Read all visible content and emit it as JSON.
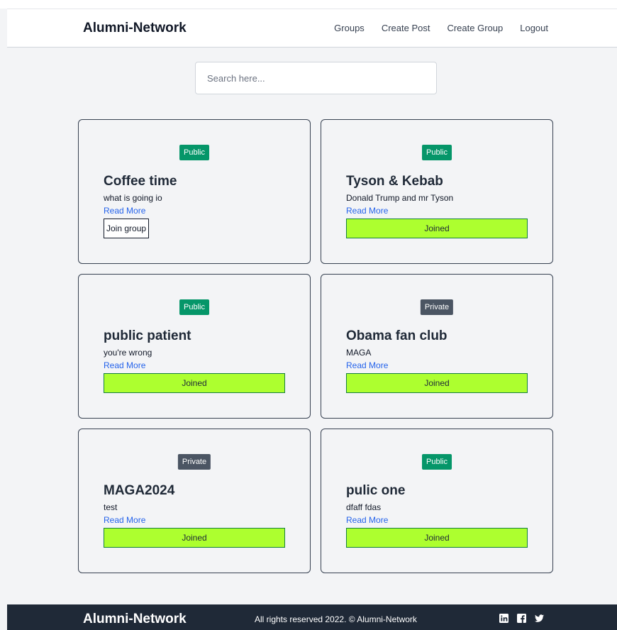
{
  "header": {
    "brand": "Alumni-Network",
    "nav": [
      {
        "label": "Groups"
      },
      {
        "label": "Create Post"
      },
      {
        "label": "Create Group"
      },
      {
        "label": "Logout"
      }
    ]
  },
  "search": {
    "placeholder": "Search here...",
    "value": ""
  },
  "groups": [
    {
      "visibility": "Public",
      "title": "Coffee time",
      "description": "what is going io",
      "read_more": "Read More",
      "status": "Join group"
    },
    {
      "visibility": "Public",
      "title": "Tyson & Kebab",
      "description": "Donald Trump and mr Tyson",
      "read_more": "Read More",
      "status": "Joined"
    },
    {
      "visibility": "Public",
      "title": "public patient",
      "description": "you're wrong",
      "read_more": "Read More",
      "status": "Joined"
    },
    {
      "visibility": "Private",
      "title": "Obama fan club",
      "description": "MAGA",
      "read_more": "Read More",
      "status": "Joined"
    },
    {
      "visibility": "Private",
      "title": "MAGA2024",
      "description": "test",
      "read_more": "Read More",
      "status": "Joined"
    },
    {
      "visibility": "Public",
      "title": "pulic one",
      "description": "dfaff fdas",
      "read_more": "Read More",
      "status": "Joined"
    }
  ],
  "footer": {
    "brand": "Alumni-Network",
    "copyright": "All rights reserved 2022. © Alumni-Network",
    "social": [
      "linkedin-icon",
      "facebook-icon",
      "twitter-icon"
    ]
  },
  "colors": {
    "public_badge": "#059669",
    "private_badge": "#4b5563",
    "joined_bg": "#adff2f",
    "link": "#2563eb",
    "footer_bg": "#1f2937"
  }
}
